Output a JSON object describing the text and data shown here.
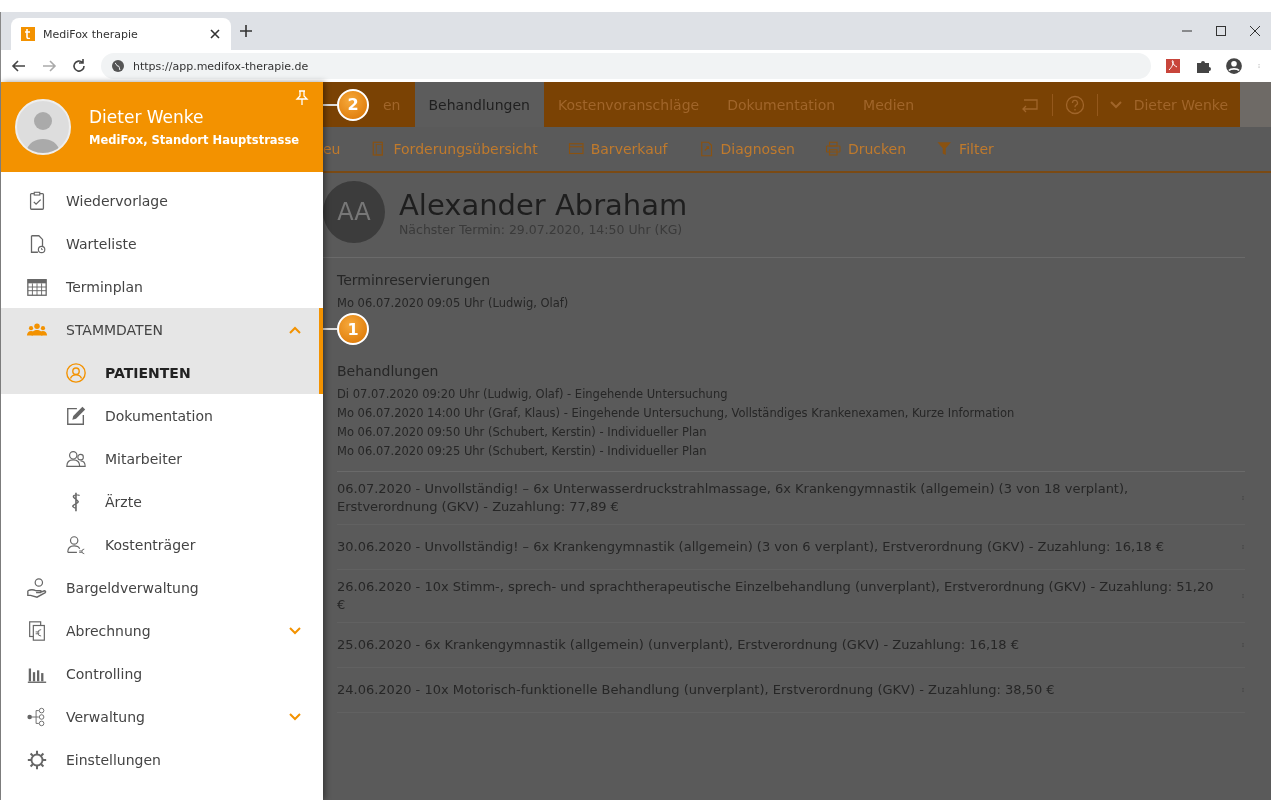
{
  "browser": {
    "tab_title": "MediFox therapie",
    "url": "https://app.medifox-therapie.de"
  },
  "drawer": {
    "user_name": "Dieter Wenke",
    "user_location": "MediFox, Standort Hauptstrasse",
    "items": [
      {
        "label": "Wiedervorlage",
        "kind": "link",
        "selected": false
      },
      {
        "label": "Warteliste",
        "kind": "link",
        "selected": false
      },
      {
        "label": "Terminplan",
        "kind": "link",
        "selected": false
      },
      {
        "label": "STAMMDATEN",
        "kind": "group",
        "selected": false,
        "expanded": true,
        "children": [
          {
            "label": "PATIENTEN",
            "selected": true
          },
          {
            "label": "Dokumentation",
            "selected": false
          },
          {
            "label": "Mitarbeiter",
            "selected": false
          },
          {
            "label": "Ärzte",
            "selected": false
          },
          {
            "label": "Kostenträger",
            "selected": false
          }
        ]
      },
      {
        "label": "Bargeldverwaltung",
        "kind": "link",
        "selected": false
      },
      {
        "label": "Abrechnung",
        "kind": "group",
        "selected": false,
        "expanded": false
      },
      {
        "label": "Controlling",
        "kind": "link",
        "selected": false
      },
      {
        "label": "Verwaltung",
        "kind": "group",
        "selected": false,
        "expanded": false
      },
      {
        "label": "Einstellungen",
        "kind": "link",
        "selected": false
      }
    ]
  },
  "callouts": [
    {
      "number": "2"
    },
    {
      "number": "1"
    }
  ],
  "tabs": [
    {
      "label": "en",
      "selected": false
    },
    {
      "label": "Behandlungen",
      "selected": true
    },
    {
      "label": "Kostenvoranschläge",
      "selected": false
    },
    {
      "label": "Dokumentation",
      "selected": false
    },
    {
      "label": "Medien",
      "selected": false
    }
  ],
  "header_user": "Dieter Wenke",
  "toolbar": [
    "eu",
    "Forderungsübersicht",
    "Barverkauf",
    "Diagnosen",
    "Drucken",
    "Filter"
  ],
  "patient": {
    "initials": "AA",
    "name": "Alexander Abraham",
    "next_appointment": "Nächster Termin: 29.07.2020, 14:50 Uhr (KG)"
  },
  "sections": [
    {
      "title": "Terminreservierungen",
      "entries": [
        "Mo 06.07.2020 09:05 Uhr (Ludwig, Olaf)"
      ]
    },
    {
      "title": "Behandlungen",
      "entries": [
        "Di 07.07.2020 09:20 Uhr (Ludwig, Olaf) - Eingehende Untersuchung",
        "Mo 06.07.2020 14:00 Uhr (Graf, Klaus) - Eingehende Untersuchung, Vollständiges Krankenexamen, Kurze Information",
        "Mo 06.07.2020 09:50 Uhr (Schubert, Kerstin) - Individueller Plan",
        "Mo 06.07.2020 09:25 Uhr (Schubert, Kerstin) - Individueller Plan"
      ]
    }
  ],
  "prescriptions": [
    {
      "text": "06.07.2020 - Unvollständig! – 6x Unterwasserdruckstrahlmassage, 6x Krankengymnastik (allgemein) (3 von 18 verplant), Erstverordnung (GKV) - Zuzahlung: 77,89 €"
    },
    {
      "text": "30.06.2020 - Unvollständig! – 6x Krankengymnastik (allgemein) (3 von 6 verplant), Erstverordnung (GKV) - Zuzahlung: 16,18 €"
    },
    {
      "text": "26.06.2020 - 10x Stimm-, sprech- und sprachtherapeutische Einzelbehandlung (unverplant), Erstverordnung (GKV) - Zuzahlung: 51,20 €"
    },
    {
      "text": "25.06.2020 - 6x Krankengymnastik (allgemein) (unverplant), Erstverordnung (GKV) - Zuzahlung: 16,18 €"
    },
    {
      "text": "24.06.2020 - 10x Motorisch-funktionelle Behandlung (unverplant), Erstverordnung (GKV) - Zuzahlung: 38,50 €"
    }
  ]
}
